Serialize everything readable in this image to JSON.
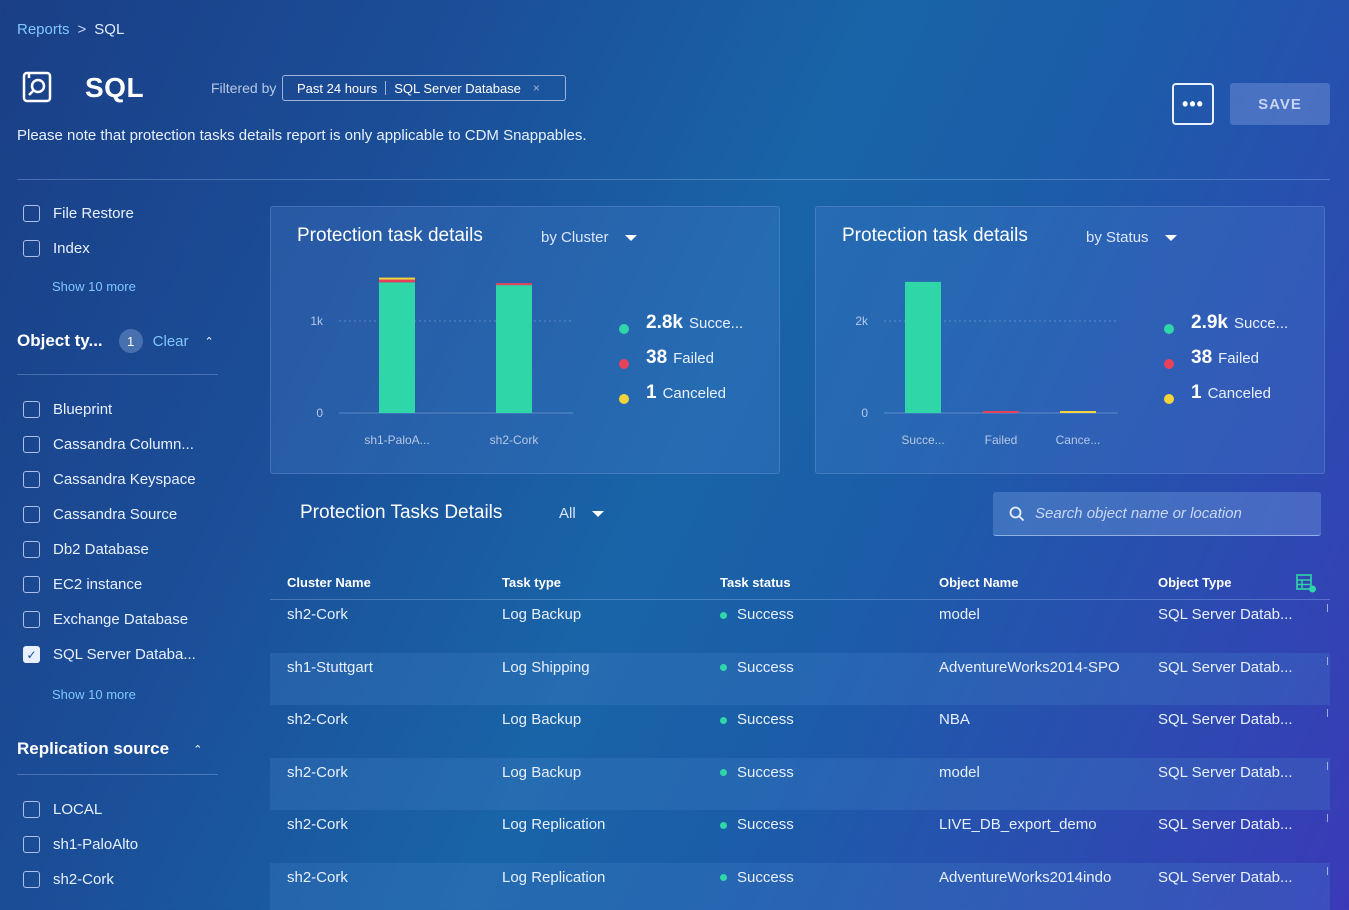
{
  "breadcrumb": {
    "root": "Reports",
    "separator": ">",
    "current": "SQL"
  },
  "header": {
    "title": "SQL",
    "filtered_by_label": "Filtered by",
    "filters": [
      "Past 24 hours",
      "SQL Server Database"
    ],
    "filter_close": "×",
    "more_label": "•••",
    "save_label": "SAVE",
    "note": "Please note that protection tasks details report is only applicable to CDM Snappables."
  },
  "sidebar": {
    "task_type_items": [
      {
        "label": "File Restore",
        "checked": false
      },
      {
        "label": "Index",
        "checked": false
      }
    ],
    "task_type_show_more": "Show 10 more",
    "object_type": {
      "title": "Object ty...",
      "count": "1",
      "clear": "Clear",
      "items": [
        {
          "label": "Blueprint",
          "checked": false
        },
        {
          "label": "Cassandra Column...",
          "checked": false
        },
        {
          "label": "Cassandra Keyspace",
          "checked": false
        },
        {
          "label": "Cassandra Source",
          "checked": false
        },
        {
          "label": "Db2 Database",
          "checked": false
        },
        {
          "label": "EC2 instance",
          "checked": false
        },
        {
          "label": "Exchange Database",
          "checked": false
        },
        {
          "label": "SQL Server Databa...",
          "checked": true
        }
      ],
      "show_more": "Show 10 more"
    },
    "replication_source": {
      "title": "Replication source",
      "items": [
        {
          "label": "LOCAL",
          "checked": false
        },
        {
          "label": "sh1-PaloAlto",
          "checked": false
        },
        {
          "label": "sh2-Cork",
          "checked": false
        }
      ]
    }
  },
  "colors": {
    "success": "#2ed6a8",
    "failed": "#e8425a",
    "canceled": "#f2d33a",
    "link": "#7fc7ff"
  },
  "chart_data": [
    {
      "type": "bar",
      "title": "Protection task details",
      "group_by": "by Cluster",
      "categories": [
        "sh1-PaloA...",
        "sh2-Cork"
      ],
      "series": [
        {
          "name": "Success",
          "values": [
            1420,
            1390
          ]
        },
        {
          "name": "Failed",
          "values": [
            30,
            8
          ]
        },
        {
          "name": "Canceled",
          "values": [
            1,
            0
          ]
        }
      ],
      "y_ticks": [
        "0",
        "1k"
      ],
      "ylim": [
        0,
        1500
      ],
      "legend": [
        {
          "value": "2.8k",
          "label": "Succe..."
        },
        {
          "value": "38",
          "label": "Failed"
        },
        {
          "value": "1",
          "label": "Canceled"
        }
      ]
    },
    {
      "type": "bar",
      "title": "Protection task details",
      "group_by": "by Status",
      "categories": [
        "Succe...",
        "Failed",
        "Cance..."
      ],
      "values": [
        2850,
        38,
        1
      ],
      "y_ticks": [
        "0",
        "2k"
      ],
      "ylim": [
        0,
        3000
      ],
      "legend": [
        {
          "value": "2.9k",
          "label": "Succe..."
        },
        {
          "value": "38",
          "label": "Failed"
        },
        {
          "value": "1",
          "label": "Canceled"
        }
      ]
    }
  ],
  "table": {
    "title": "Protection Tasks Details",
    "filter": "All",
    "search_placeholder": "Search object name or location",
    "columns": [
      "Cluster Name",
      "Task type",
      "Task status",
      "Object Name",
      "Object Type"
    ],
    "rows": [
      {
        "cluster": "sh2-Cork",
        "task_type": "Log Backup",
        "status": "Success",
        "object": "model",
        "object_type": "SQL Server Datab..."
      },
      {
        "cluster": "sh1-Stuttgart",
        "task_type": "Log Shipping",
        "status": "Success",
        "object": "AdventureWorks2014-SPO",
        "object_type": "SQL Server Datab..."
      },
      {
        "cluster": "sh2-Cork",
        "task_type": "Log Backup",
        "status": "Success",
        "object": "NBA",
        "object_type": "SQL Server Datab..."
      },
      {
        "cluster": "sh2-Cork",
        "task_type": "Log Backup",
        "status": "Success",
        "object": "model",
        "object_type": "SQL Server Datab..."
      },
      {
        "cluster": "sh2-Cork",
        "task_type": "Log Replication",
        "status": "Success",
        "object": "LIVE_DB_export_demo",
        "object_type": "SQL Server Datab..."
      },
      {
        "cluster": "sh2-Cork",
        "task_type": "Log Replication",
        "status": "Success",
        "object": "AdventureWorks2014indo",
        "object_type": "SQL Server Datab..."
      }
    ]
  }
}
